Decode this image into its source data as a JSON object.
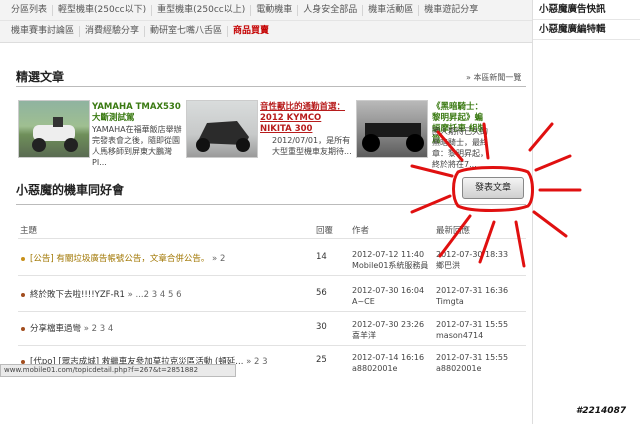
{
  "nav": {
    "row1": [
      "分區列表",
      "輕型機車(250cc以下)",
      "重型機車(250cc以上)",
      "電動機車",
      "人身安全部品",
      "機車活動區",
      "機車遊記分享"
    ],
    "row2": [
      "機車賽事討論區",
      "消費經驗分享",
      "動研室七嘴八舌區",
      "商品買賣"
    ]
  },
  "sidebar": {
    "items": [
      "小惡魔廣告快訊",
      "小惡魔廣編特輯"
    ]
  },
  "featured": {
    "title": "精選文章",
    "more_link": "» 本區新聞一覽",
    "cards": [
      {
        "title": "YAMAHA TMAX530 大斷測試駕",
        "text": "YAMAHA在福華飯店舉辦完發表會之後，隨即從園人馬移師到屏東大鵬灣PI..."
      },
      {
        "title": "音性獸比的通勤首選：2012 KYMCO NIKITA 300",
        "text": "2012/07/01，是所有大型重型機車友期待..."
      },
      {
        "title": "《黑暗騎士：黎明昇起》蝙蝠摩托車 組裝篇",
        "text": "國人期待已久的黑暗騎士，最終章：黎明昇起，終於將在7..."
      }
    ]
  },
  "forum": {
    "title": "小惡魔的機車同好會",
    "post_button": "發表文章",
    "columns": {
      "topic": "主題",
      "replies": "回覆",
      "author": "作者",
      "last": "最新回應"
    },
    "rows": [
      {
        "topic": "[公告] 有關垃圾廣告帳號公告，文章合併公告。",
        "pages": "» 2",
        "replies": "14",
        "author_date": "2012-07-12 11:40",
        "author": "Mobile01系統服務員",
        "last_date": "2012-07-30 18:33",
        "last_user": "鄉巴洪",
        "notice": true
      },
      {
        "topic": "終於敗下去啦!!!!YZF-R1",
        "pages": "» ...2 3 4 5 6",
        "replies": "56",
        "author_date": "2012-07-30 16:04",
        "author": "A~CE",
        "last_date": "2012-07-31 16:36",
        "last_user": "Timgta",
        "notice": false
      },
      {
        "topic": "分享檔車過彎",
        "pages": "» 2 3 4",
        "replies": "30",
        "author_date": "2012-07-30 23:26",
        "author": "喜羊洋",
        "last_date": "2012-07-31 15:55",
        "last_user": "mason4714",
        "notice": false
      },
      {
        "topic": "[代po] [眾志成城] 救繼車友參加莫拉克災區活動 (頓延...",
        "pages": "» 2 3",
        "replies": "25",
        "author_date": "2012-07-14 16:16",
        "author": "a8802001e",
        "last_date": "2012-07-31 15:55",
        "last_user": "a8802001e",
        "notice": false
      }
    ]
  },
  "status_bar": "www.mobile01.com/topicdetail.php?f=267&t=2851882",
  "watermark": "#2214087",
  "colors": {
    "annotation": "#e01010",
    "green_title": "#3a7a12",
    "red_title": "#b71c1c"
  }
}
